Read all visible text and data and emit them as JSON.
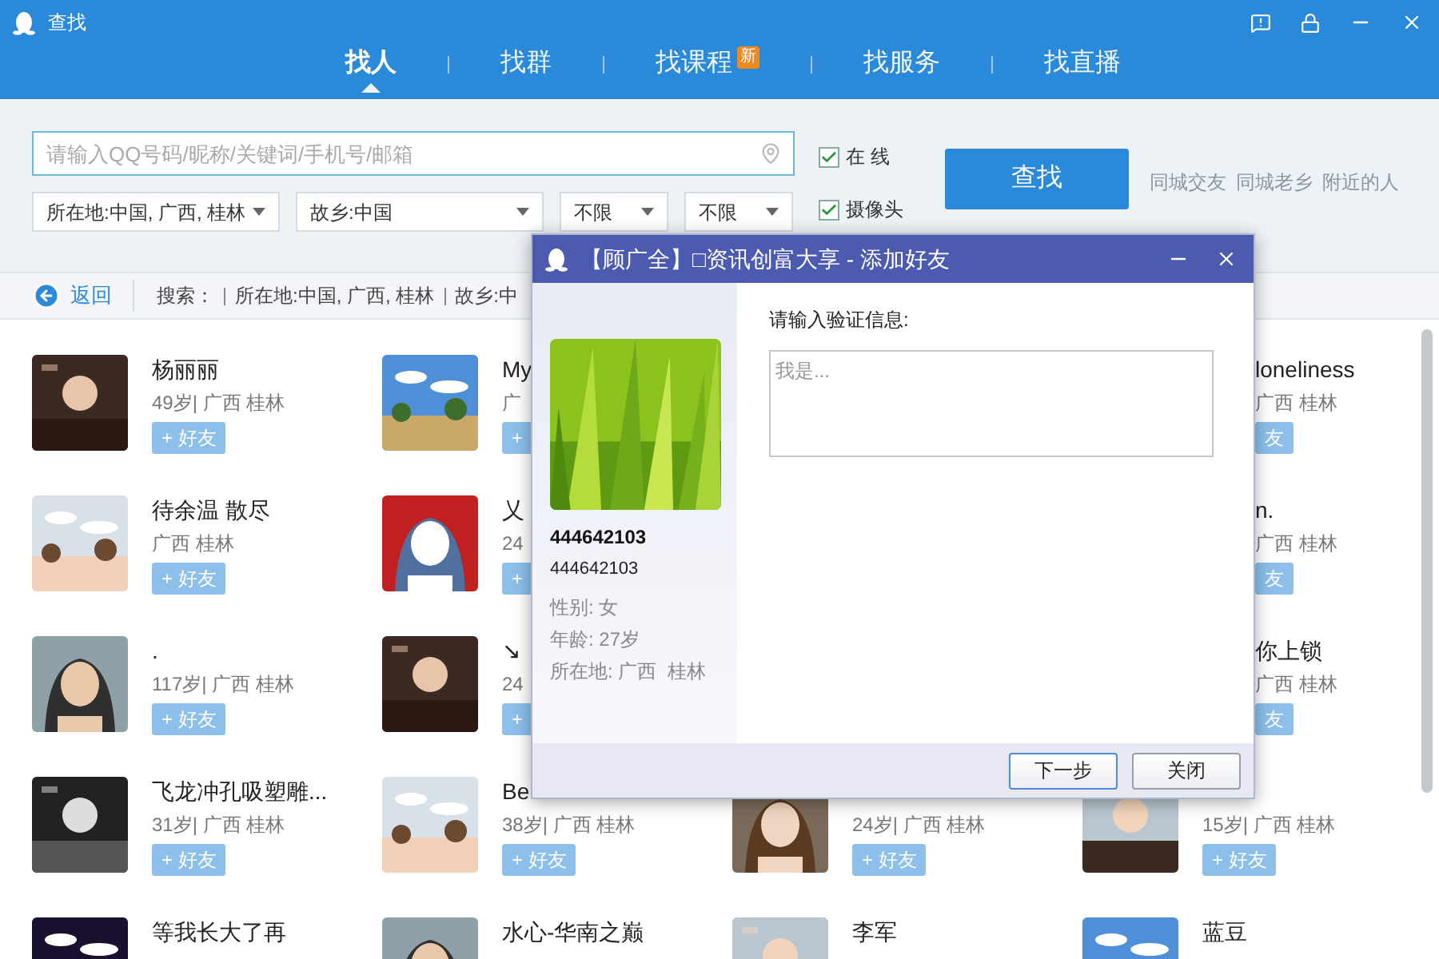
{
  "window": {
    "title": "查找"
  },
  "tabs": [
    {
      "label": "找人",
      "selected": true
    },
    {
      "label": "找群",
      "selected": false
    },
    {
      "label": "找课程",
      "selected": false,
      "badge": "新"
    },
    {
      "label": "找服务",
      "selected": false
    },
    {
      "label": "找直播",
      "selected": false
    }
  ],
  "search": {
    "placeholder": "请输入QQ号码/昵称/关键词/手机号/邮箱",
    "filters": [
      "所在地:中国, 广西, 桂林",
      "故乡:中国",
      "不限",
      "不限"
    ],
    "options": [
      {
        "label": "在 线",
        "checked": true
      },
      {
        "label": "摄像头",
        "checked": true
      }
    ],
    "button": "查找",
    "links": [
      "同城交友",
      "同城老乡",
      "附近的人"
    ]
  },
  "breadcrumb": {
    "back": "返回",
    "label": "搜索：",
    "criteria": [
      "所在地:中国, 广西, 桂林",
      "故乡:中"
    ]
  },
  "results": [
    [
      {
        "kind": "contact",
        "name": "杨丽丽",
        "info": "49岁| 广西 桂林",
        "button": "+ 好友"
      },
      {
        "kind": "contact",
        "name": "待余温 散尽",
        "info": "广西 桂林",
        "button": "+ 好友"
      },
      {
        "kind": "contact",
        "name": ".",
        "info": "117岁| 广西 桂林",
        "button": "+ 好友"
      },
      {
        "kind": "contact",
        "name": "飞龙冲孔吸塑雕...",
        "info": "31岁| 广西 桂林",
        "button": "+ 好友"
      },
      {
        "kind": "contact",
        "name": "等我长大了再"
      }
    ],
    [
      {
        "kind": "contact",
        "name": "My",
        "info": "广",
        "button": "+"
      },
      {
        "kind": "contact",
        "name": "乂",
        "info": "24",
        "button": "+"
      },
      {
        "kind": "contact",
        "name": "↘",
        "info": "24",
        "button": "+"
      },
      {
        "kind": "contact",
        "name": "Be",
        "info": "38岁| 广西 桂林",
        "button": "+ 好友"
      },
      {
        "kind": "contact",
        "name": "水心-华南之巅"
      }
    ],
    [
      {
        "kind": "contact",
        "info": "24岁| 广西 桂林",
        "button": "+ 好友"
      },
      {
        "kind": "contact",
        "name": "李军"
      }
    ],
    [
      {
        "kind": "clipped",
        "name": "loneliness",
        "info": "广西 桂林",
        "button": "友"
      },
      {
        "kind": "clipped",
        "name": "n.",
        "info": "广西 桂林",
        "button": "友"
      },
      {
        "kind": "clipped",
        "name": "你上锁",
        "info": "广西 桂林",
        "button": "友"
      },
      {
        "kind": "contact",
        "info": "15岁| 广西 桂林",
        "button": "+ 好友"
      },
      {
        "kind": "contact",
        "name": "蓝豆"
      }
    ]
  ],
  "dialog": {
    "title": "【顾广全】□资讯创富大享 - 添加好友",
    "profile": {
      "name": "444642103",
      "number": "444642103",
      "details": [
        "性别: 女",
        "年龄: 27岁",
        "所在地: 广西  桂林"
      ]
    },
    "prompt": "请输入验证信息:",
    "placeholder": "我是...",
    "buttons": [
      {
        "label": "下一步",
        "selected": true
      },
      {
        "label": "关闭",
        "selected": false
      }
    ]
  }
}
